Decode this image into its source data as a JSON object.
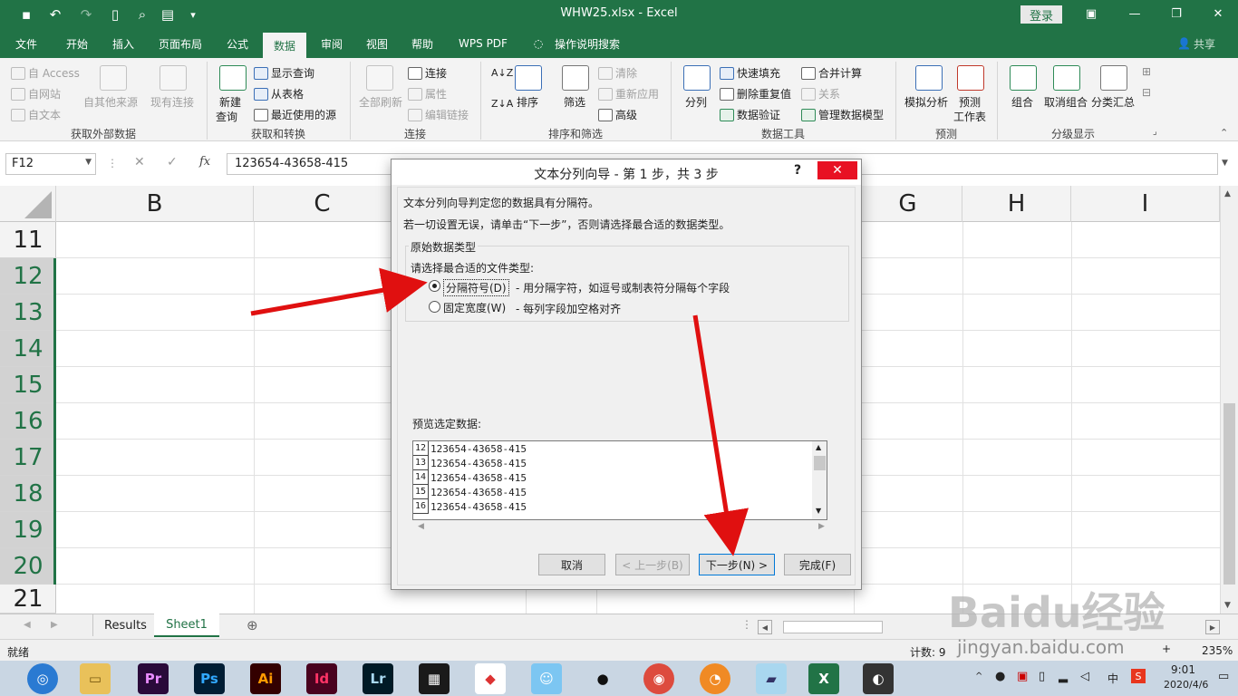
{
  "titlebar": {
    "title": "WHW25.xlsx  -  Excel",
    "login": "登录",
    "quick_access": [
      "save-icon",
      "undo-icon",
      "redo-icon",
      "new-file-icon",
      "print-preview-icon",
      "form-icon",
      "customize-icon"
    ]
  },
  "tabs": [
    "文件",
    "开始",
    "插入",
    "页面布局",
    "公式",
    "数据",
    "审阅",
    "视图",
    "帮助",
    "WPS PDF",
    "操作说明搜索"
  ],
  "share": "共享",
  "ribbon": {
    "get_external": {
      "label": "获取外部数据",
      "items": [
        "自 Access",
        "自网站",
        "自文本",
        "自其他来源",
        "现有连接"
      ]
    },
    "get_transform": {
      "label": "获取和转换",
      "new_query": "新建",
      "new_query2": "查询",
      "items": [
        "显示查询",
        "从表格",
        "最近使用的源"
      ]
    },
    "connections": {
      "label": "连接",
      "refresh": "全部刷新",
      "items": [
        "连接",
        "属性",
        "编辑链接"
      ]
    },
    "sort_filter": {
      "label": "排序和筛选",
      "sort": "排序",
      "filter": "筛选",
      "items": [
        "清除",
        "重新应用",
        "高级"
      ]
    },
    "data_tools": {
      "label": "数据工具",
      "split": "分列",
      "items": [
        "快速填充",
        "删除重复值",
        "数据验证",
        "合并计算",
        "关系",
        "管理数据模型"
      ]
    },
    "forecast": {
      "label": "预测",
      "whatif": "模拟分析",
      "sheet": "预测",
      "sheet2": "工作表"
    },
    "outline": {
      "label": "分级显示",
      "group": "组合",
      "ungroup": "取消组合",
      "subtotal": "分类汇总"
    }
  },
  "formula_bar": {
    "namebox": "F12",
    "fx": "fx",
    "value": "123654-43658-415"
  },
  "columns": [
    "B",
    "C",
    "G",
    "H",
    "I"
  ],
  "rows": [
    "11",
    "12",
    "13",
    "14",
    "15",
    "16",
    "17",
    "18",
    "19",
    "20",
    "21"
  ],
  "sheets": [
    "Results",
    "Sheet1"
  ],
  "status": {
    "ready": "就绪",
    "count": "计数: 9",
    "zoom": "235%"
  },
  "taskbar": {
    "time": "9:01",
    "date": "2020/4/6",
    "ime": "中"
  },
  "dialog": {
    "title": "文本分列向导 - 第 1 步，共 3 步",
    "help": "?",
    "close": "✕",
    "line1": "文本分列向导判定您的数据具有分隔符。",
    "line2": "若一切设置无误，请单击“下一步”，否则请选择最合适的数据类型。",
    "group_title": "原始数据类型",
    "choose": "请选择最合适的文件类型:",
    "opt1": "分隔符号(D)",
    "opt1_desc": "- 用分隔字符，如逗号或制表符分隔每个字段",
    "opt2": "固定宽度(W)",
    "opt2_desc": "- 每列字段加空格对齐",
    "preview_label": "预览选定数据:",
    "preview": [
      {
        "row": "12",
        "value": "123654-43658-415"
      },
      {
        "row": "13",
        "value": "123654-43658-415"
      },
      {
        "row": "14",
        "value": "123654-43658-415"
      },
      {
        "row": "15",
        "value": "123654-43658-415"
      },
      {
        "row": "16",
        "value": "123654-43658-415"
      }
    ],
    "buttons": {
      "cancel": "取消",
      "back": "< 上一步(B)",
      "next": "下一步(N) >",
      "finish": "完成(F)"
    }
  },
  "watermark": "Baidu经验",
  "watermark_url": "jingyan.baidu.com"
}
